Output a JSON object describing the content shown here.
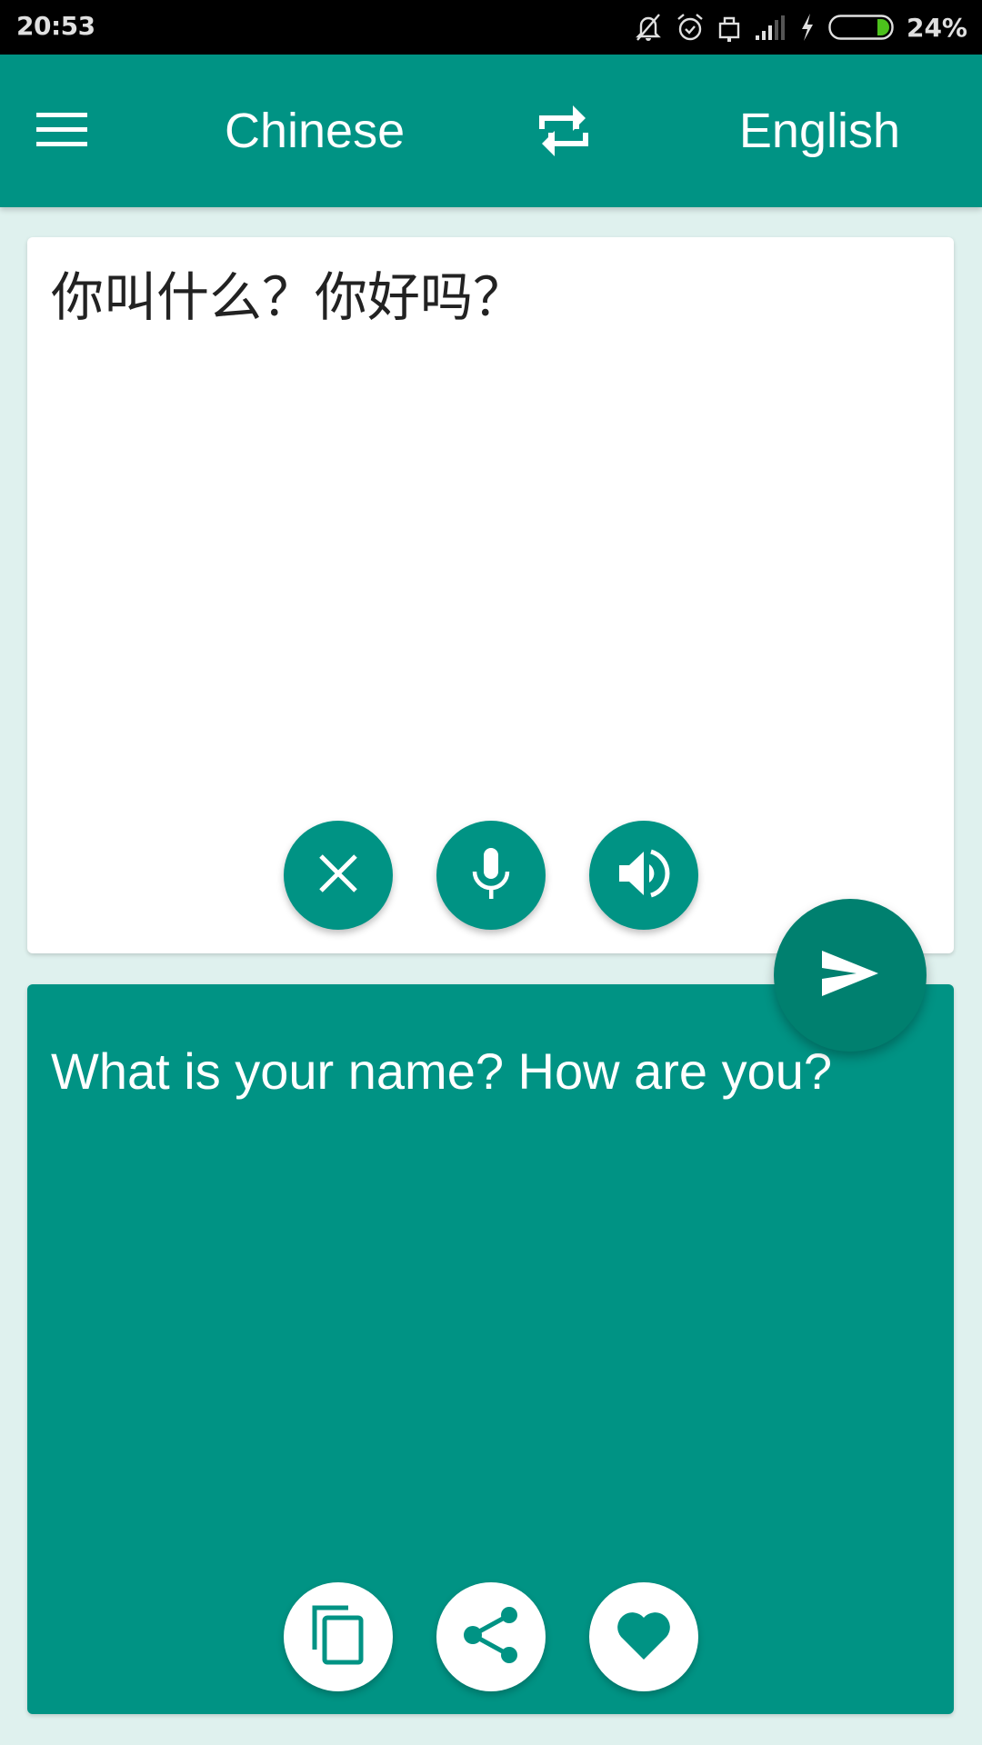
{
  "status_bar": {
    "time": "20:53",
    "icons": [
      "notifications-off-icon",
      "alarm-icon",
      "lock-icon",
      "signal-icon",
      "charging-icon",
      "battery-icon"
    ],
    "battery_percent": "24%",
    "battery_level": 0.24,
    "battery_color": "#4cc11c"
  },
  "toolbar": {
    "menu_icon": "hamburger-menu-icon",
    "source_language": "Chinese",
    "swap_icon": "swap-languages-icon",
    "target_language": "English",
    "background_color": "#009384"
  },
  "input_card": {
    "text": "你叫什么？你好吗？",
    "buttons": [
      {
        "name": "clear",
        "icon": "close-icon"
      },
      {
        "name": "voice-input",
        "icon": "microphone-icon"
      },
      {
        "name": "speak",
        "icon": "speaker-icon"
      }
    ]
  },
  "send_button": {
    "icon": "send-icon",
    "color": "#00806f"
  },
  "output_card": {
    "text": "What is your name? How are you?",
    "buttons": [
      {
        "name": "copy",
        "icon": "copy-icon"
      },
      {
        "name": "share",
        "icon": "share-icon"
      },
      {
        "name": "favorite",
        "icon": "heart-icon"
      }
    ]
  }
}
